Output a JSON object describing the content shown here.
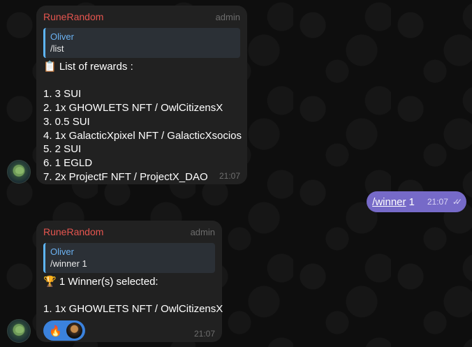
{
  "messages": [
    {
      "sender": "RuneRandom",
      "role": "admin",
      "reply": {
        "author": "Oliver",
        "text": "/list"
      },
      "header_line": "List of rewards :",
      "header_icon": "clipboard-icon",
      "lines": [
        "1. 3 SUI",
        "2. 1x GHOWLETS NFT / OwlCitizensX",
        "3. 0.5 SUI",
        "4. 1x GalacticXpixel NFT / GalacticXsocios",
        "5. 2 SUI",
        "6. 1 EGLD",
        "7. 2x ProjectF NFT / ProjectX_DAO"
      ],
      "time": "21:07"
    },
    {
      "outgoing": true,
      "command": "/winner",
      "argument": "1",
      "time": "21:07",
      "status": "read"
    },
    {
      "sender": "RuneRandom",
      "role": "admin",
      "reply": {
        "author": "Oliver",
        "text": "/winner 1"
      },
      "header_line": "1 Winner(s) selected:",
      "header_icon": "trophy-icon",
      "lines": [
        "1. 1x GHOWLETS NFT / OwlCitizensX"
      ],
      "reaction": {
        "emoji": "🔥",
        "icon": "fire-icon"
      },
      "time": "21:07"
    }
  ],
  "colors": {
    "background": "#0e0e0e",
    "bubble_incoming": "#212121",
    "bubble_outgoing": "#766ac8",
    "sender_name": "#e5554f",
    "reply_accent": "#5eb5f7",
    "reaction_pill": "#3b82dd"
  }
}
